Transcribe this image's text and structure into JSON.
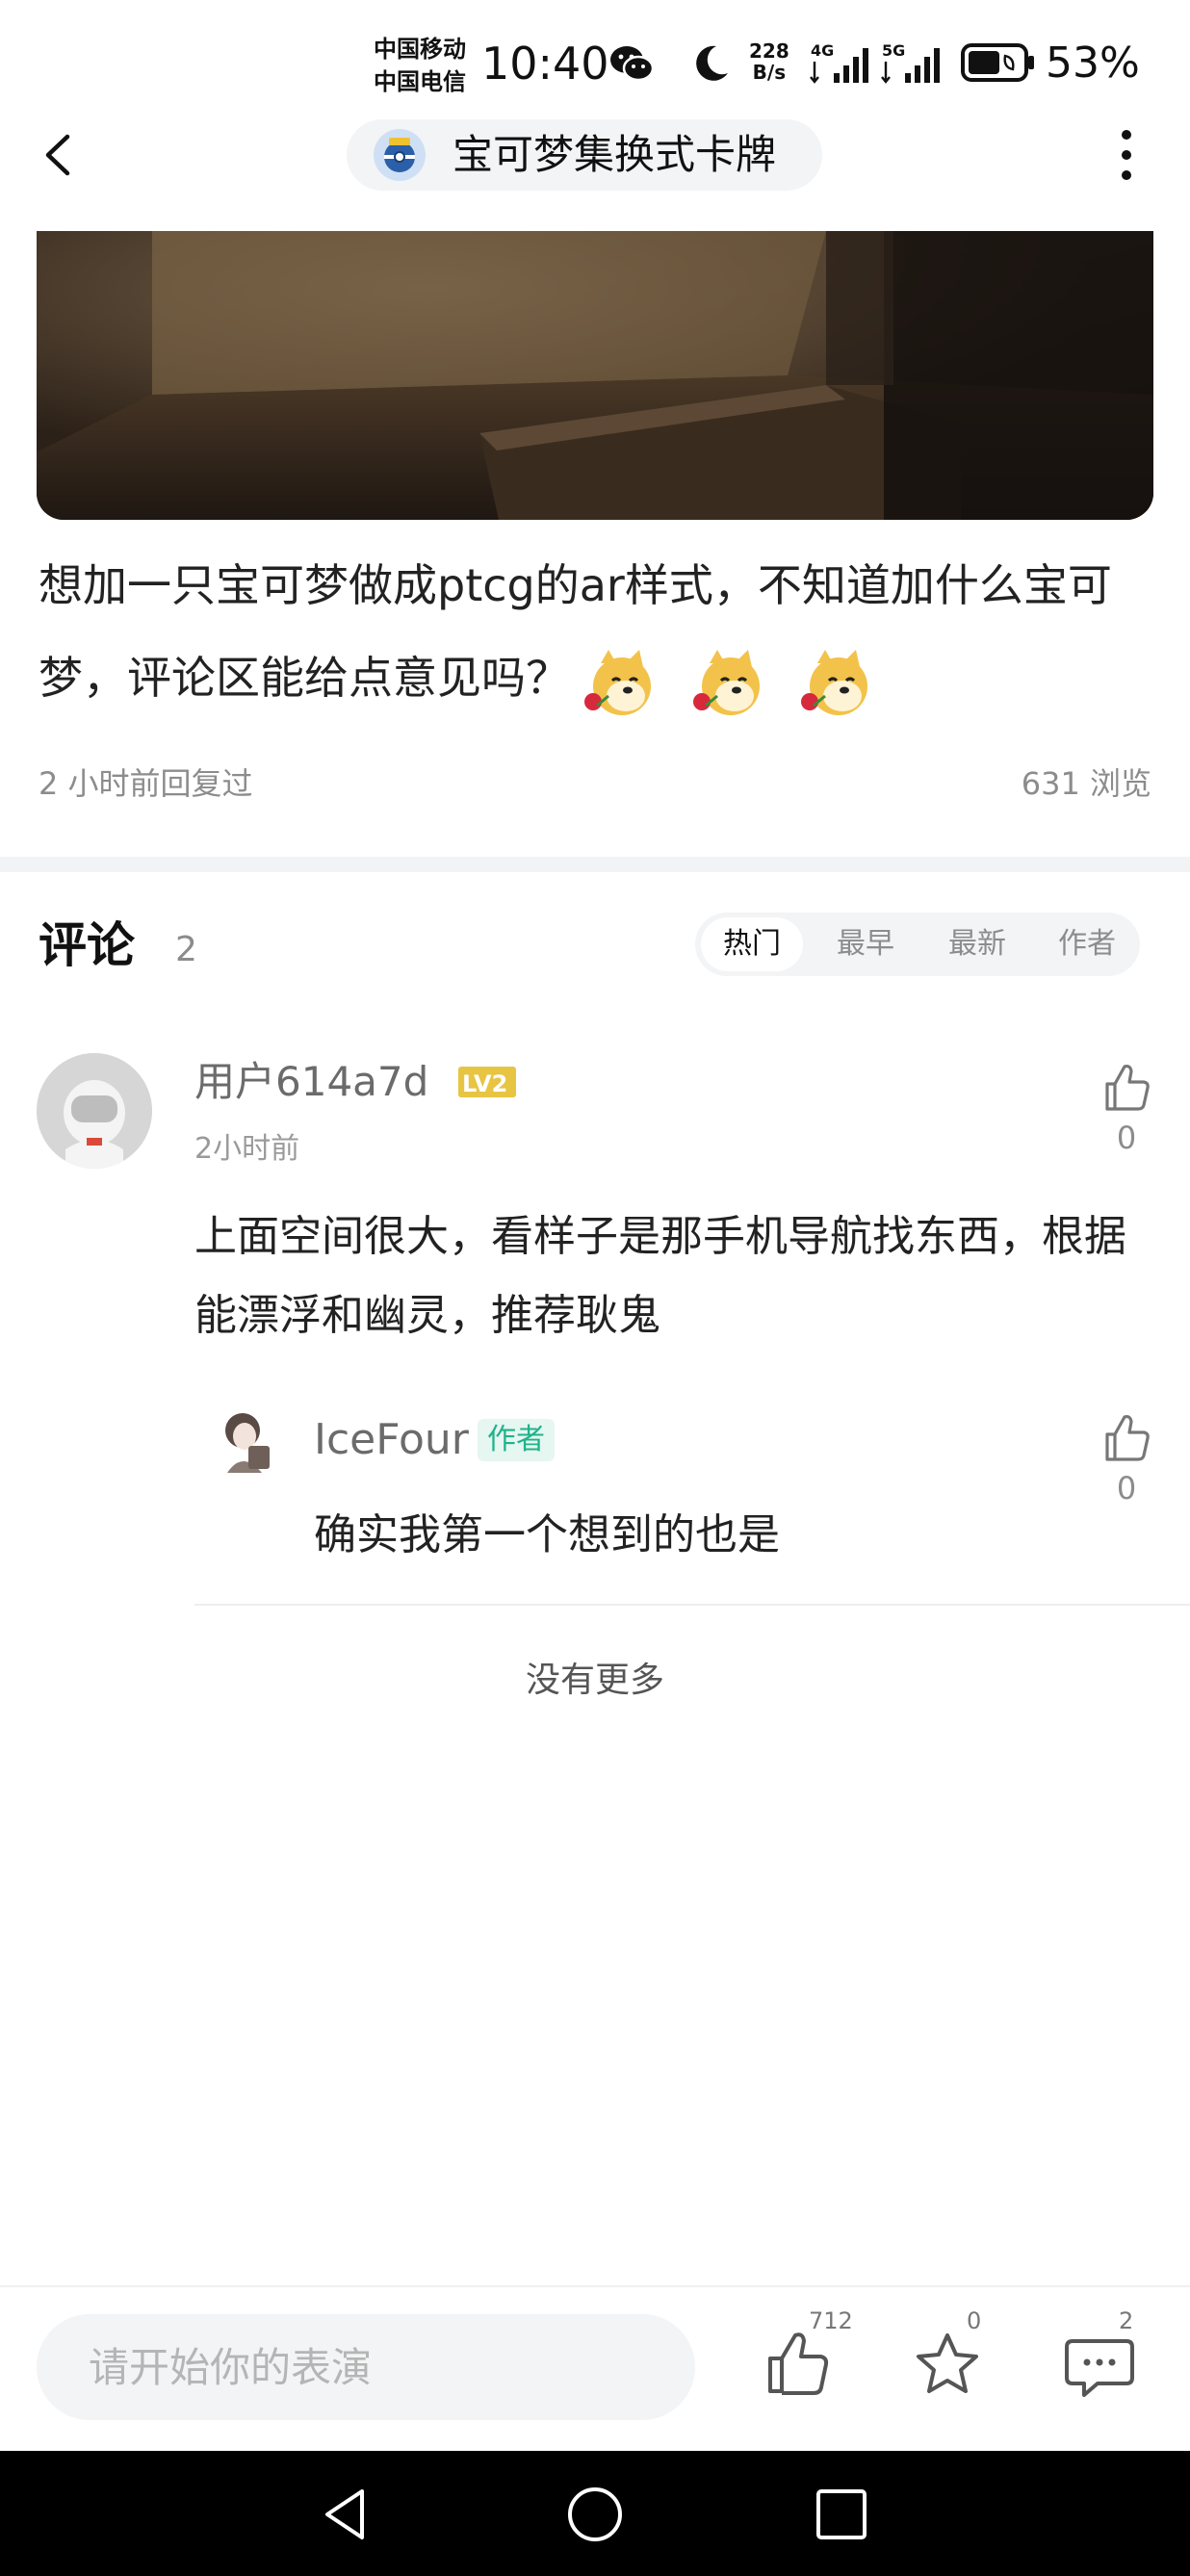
{
  "status_bar": {
    "carrier_line1": "中国移动",
    "carrier_line2": "中国电信",
    "time": "10:40",
    "net_speed_value": "228",
    "net_speed_unit": "B/s",
    "sim1_type": "4G",
    "sim2_type": "5G",
    "battery_percent": "53%",
    "icons": [
      "wechat-icon",
      "moon-icon",
      "signal-icon",
      "battery-icon"
    ]
  },
  "header": {
    "topic_title": "宝可梦集换式卡牌",
    "icons": [
      "back-icon",
      "more-vertical-icon"
    ]
  },
  "post": {
    "text": "想加一只宝可梦做成ptcg的ar样式，不知道加什么宝可梦，评论区能给点意见吗？",
    "emoji_count": 3,
    "emoji_icon": "doge-rose-emoji",
    "reply_time": "2 小时前回复过",
    "views": "631 浏览"
  },
  "comments_section": {
    "title": "评论",
    "count": "2",
    "sort_tabs": [
      {
        "label": "热门",
        "active": true
      },
      {
        "label": "最早",
        "active": false
      },
      {
        "label": "最新",
        "active": false
      },
      {
        "label": "作者",
        "active": false
      }
    ],
    "comments": [
      {
        "username": "用户614a7d",
        "level": "LV2",
        "time": "2小时前",
        "text": "上面空间很大，看样子是那手机导航找东西，根据能漂浮和幽灵，推荐耿鬼",
        "likes": "0",
        "replies": [
          {
            "username": "IceFour",
            "badge": "作者",
            "text": "确实我第一个想到的也是",
            "likes": "0"
          }
        ]
      }
    ],
    "no_more": "没有更多"
  },
  "bottom_bar": {
    "input_placeholder": "请开始你的表演",
    "like_count": "712",
    "favorite_count": "0",
    "comment_count": "2"
  },
  "colors": {
    "author_badge_text": "#1fb38a",
    "author_badge_bg": "#e6f6f1",
    "level_badge": "#e8c443",
    "muted_text": "#8c8c8c"
  }
}
